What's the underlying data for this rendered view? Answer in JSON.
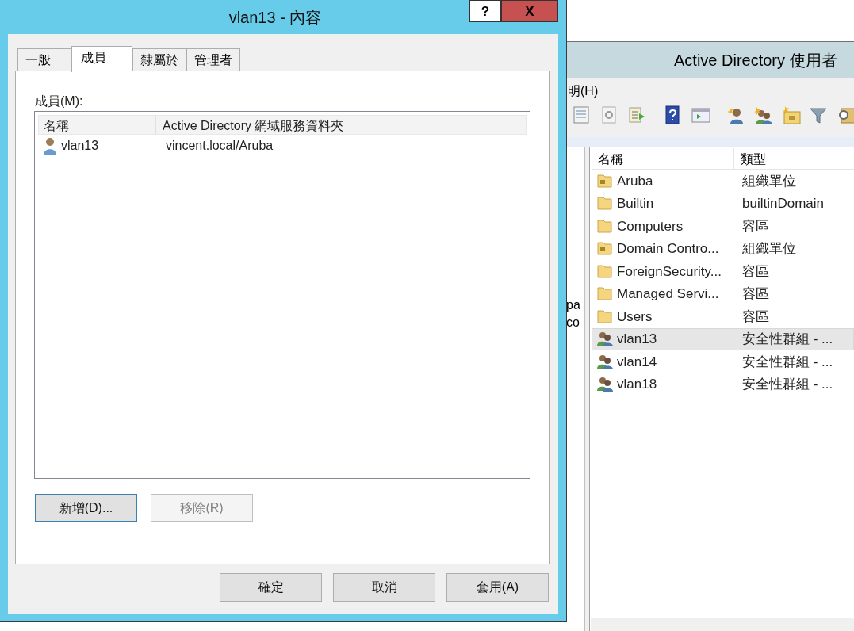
{
  "ad_window": {
    "title": "Active Directory 使用者",
    "menu": [
      "明(H)"
    ],
    "tree_fragments": [
      "pa",
      "co"
    ],
    "columns": [
      "名稱",
      "類型"
    ],
    "rows": [
      {
        "kind": "ou",
        "name": "Aruba",
        "type": "組織單位",
        "selected": false
      },
      {
        "kind": "folder",
        "name": "Builtin",
        "type": "builtinDomain",
        "selected": false
      },
      {
        "kind": "folder",
        "name": "Computers",
        "type": "容區",
        "selected": false
      },
      {
        "kind": "ou",
        "name": "Domain Contro...",
        "type": "組織單位",
        "selected": false
      },
      {
        "kind": "folder",
        "name": "ForeignSecurity...",
        "type": "容區",
        "selected": false
      },
      {
        "kind": "folder",
        "name": "Managed Servi...",
        "type": "容區",
        "selected": false
      },
      {
        "kind": "folder",
        "name": "Users",
        "type": "容區",
        "selected": false
      },
      {
        "kind": "group",
        "name": "vlan13",
        "type": "安全性群組 - ...",
        "selected": true
      },
      {
        "kind": "group",
        "name": "vlan14",
        "type": "安全性群組 - ...",
        "selected": false
      },
      {
        "kind": "group",
        "name": "vlan18",
        "type": "安全性群組 - ...",
        "selected": false
      }
    ]
  },
  "dialog": {
    "title": "vlan13 - 內容",
    "help": "?",
    "close": "X",
    "tabs": [
      {
        "label": "一般",
        "selected": false
      },
      {
        "label": "成員",
        "selected": true
      },
      {
        "label": "隸屬於",
        "selected": false
      },
      {
        "label": "管理者",
        "selected": false
      }
    ],
    "members_label": "成員(M):",
    "columns": [
      "名稱",
      "Active Directory 網域服務資料夾"
    ],
    "members": [
      {
        "name": "vlan13",
        "folder": "vincent.local/Aruba"
      }
    ],
    "list_buttons": [
      {
        "label": "新增(D)...",
        "disabled": false,
        "focused": true
      },
      {
        "label": "移除(R)",
        "disabled": true,
        "focused": false
      }
    ],
    "buttons": [
      "確定",
      "取消",
      "套用(A)"
    ]
  }
}
